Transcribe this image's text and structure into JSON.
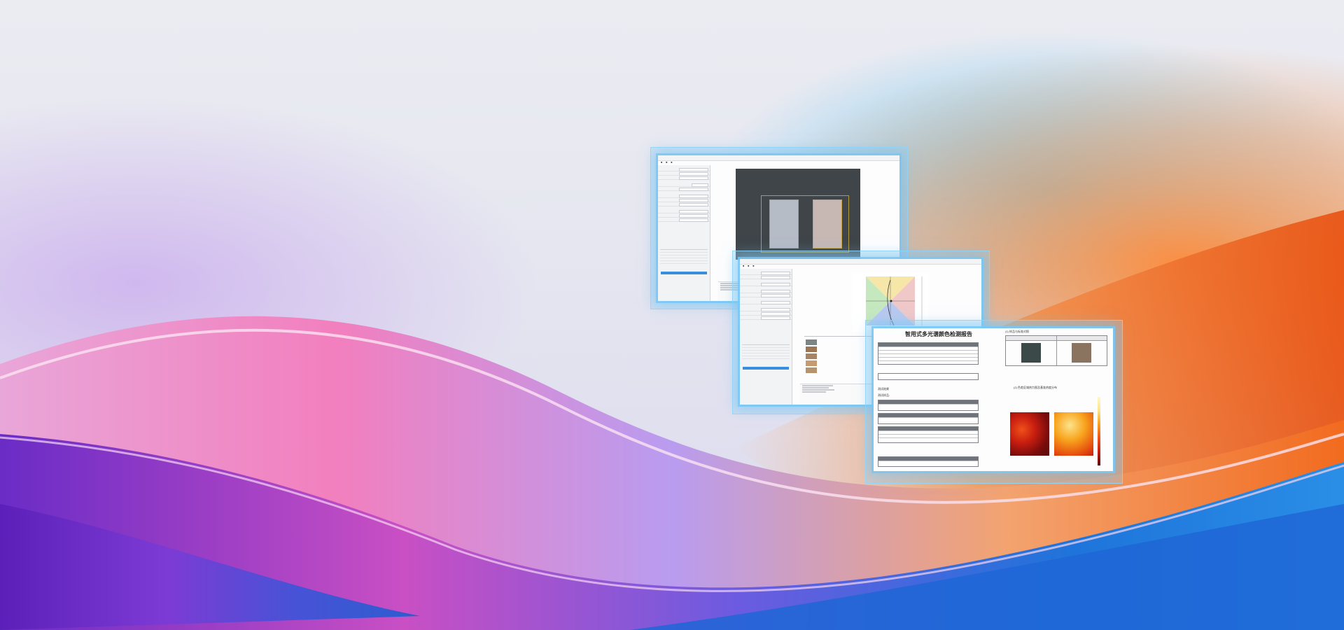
{
  "background": {
    "base_color": "#e9eaf1",
    "wave_colors": [
      "#7a3bd6",
      "#e874c2",
      "#f07a2a",
      "#1e6fd8",
      "#9fd4f5"
    ]
  },
  "windows": [
    {
      "id": "measurement-window",
      "role": "camera capture interface",
      "content": [
        "left parameter panel",
        "camera preview with two samples",
        "log panel"
      ]
    },
    {
      "id": "analysis-window",
      "role": "color analysis interface",
      "content": [
        "left parameter panel",
        "color space diagram",
        "sample result table"
      ]
    },
    {
      "id": "report-window",
      "title": "智用式多光谱颜色检测报告",
      "sections": [
        "测试结果",
        "测试样品:",
        "(2) 色差区域热力图及基准热度分布",
        "(1) 样品与标准对照"
      ],
      "heatmap_colors": [
        "#5a0a0a",
        "#c81e10",
        "#f0501a",
        "#f7a31c",
        "#fde38a",
        "#fff8c8"
      ]
    }
  ]
}
